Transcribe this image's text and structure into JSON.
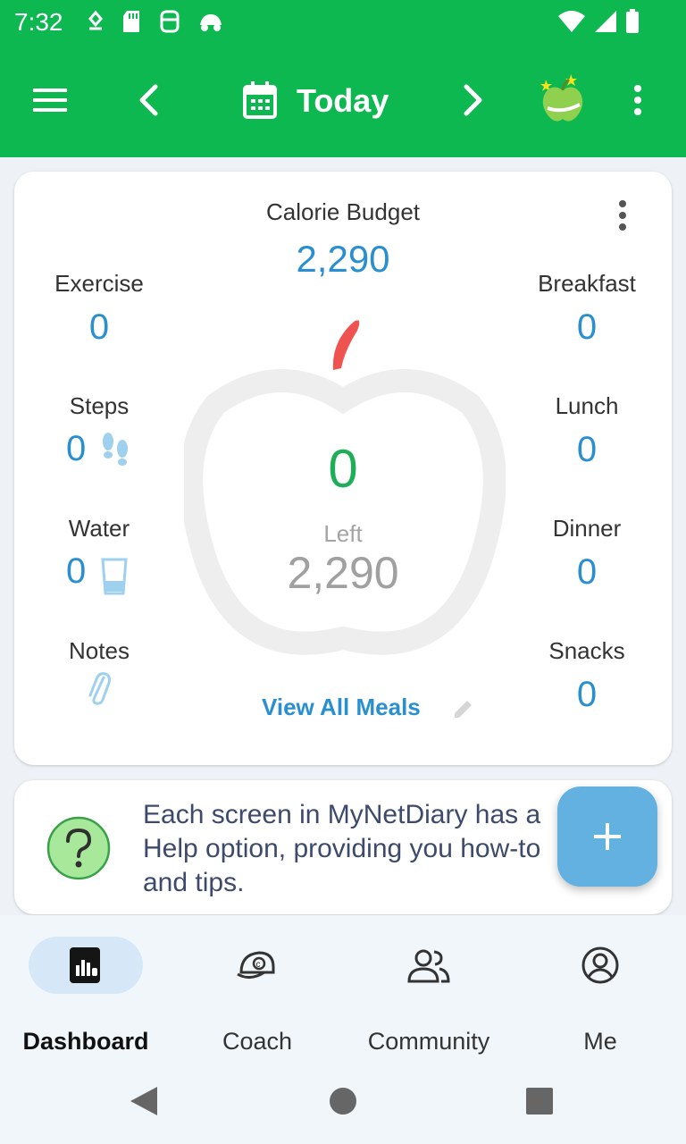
{
  "status_bar": {
    "time": "7:32",
    "icons": [
      "location-icon",
      "sd-card-icon",
      "sync-icon",
      "car-icon"
    ],
    "right_icons": [
      "wifi-icon",
      "signal-icon",
      "battery-icon"
    ]
  },
  "app_bar": {
    "title": "Today",
    "icons": [
      "menu-icon",
      "chevron-left-icon",
      "calendar-icon",
      "chevron-right-icon",
      "apple-logo-icon",
      "more-vert-icon"
    ],
    "color": "#0cb84f"
  },
  "summary": {
    "calorie_budget_label": "Calorie Budget",
    "calorie_budget_value": "2,290",
    "exercise": {
      "label": "Exercise",
      "value": "0"
    },
    "steps": {
      "label": "Steps",
      "value": "0"
    },
    "water": {
      "label": "Water",
      "value": "0"
    },
    "notes": {
      "label": "Notes"
    },
    "breakfast": {
      "label": "Breakfast",
      "value": "0"
    },
    "lunch": {
      "label": "Lunch",
      "value": "0"
    },
    "dinner": {
      "label": "Dinner",
      "value": "0"
    },
    "snacks": {
      "label": "Snacks",
      "value": "0"
    },
    "consumed": "0",
    "left_label": "Left",
    "left_value": "2,290",
    "view_all_meals": "View All Meals"
  },
  "help": {
    "line1": "Each screen in MyNetDiary has a",
    "line2": "Help option, providing you how-to",
    "line3": "and tips."
  },
  "fab": {
    "icon": "plus-icon",
    "color": "#63b1e1"
  },
  "bottom_nav": {
    "items": [
      {
        "label": "Dashboard",
        "icon": "dashboard-icon",
        "active": true
      },
      {
        "label": "Coach",
        "icon": "coach-icon",
        "active": false
      },
      {
        "label": "Community",
        "icon": "community-icon",
        "active": false
      },
      {
        "label": "Me",
        "icon": "profile-icon",
        "active": false
      }
    ]
  },
  "system_nav": [
    "back-icon",
    "home-icon",
    "recents-icon"
  ]
}
